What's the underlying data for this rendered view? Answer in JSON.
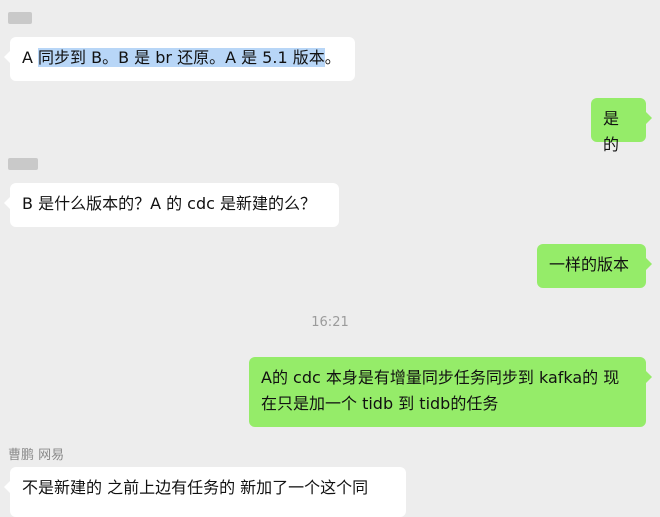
{
  "conversation": {
    "messages": [
      {
        "id": "m1",
        "direction": "incoming",
        "sender": "",
        "prefix": "A ",
        "selected": "同步到 B。B 是 br 还原。A 是 5.1 版本",
        "suffix": "。"
      },
      {
        "id": "m2",
        "direction": "outgoing",
        "text": "是的"
      },
      {
        "id": "m3",
        "direction": "incoming",
        "sender": "",
        "text": "B 是什么版本的？A 的 cdc 是新建的么？"
      },
      {
        "id": "m4",
        "direction": "outgoing",
        "text": "一样的版本"
      },
      {
        "id": "m5",
        "direction": "outgoing",
        "line1": "A的 cdc 本身是有增量同步任务同步到 kafka的 现",
        "line2": "在只是加一个 tidb 到 tidb的任务"
      },
      {
        "id": "m6",
        "direction": "incoming",
        "sender": "曹鹏 网易",
        "text": "不是新建的 之前上边有任务的 新加了一个这个同"
      }
    ],
    "timestamp": "16:21"
  },
  "theme": {
    "background": "#ededed",
    "incoming_bubble": "#ffffff",
    "outgoing_bubble": "#95ec69",
    "selection": "#b8d6f7",
    "meta_text": "#9b9b9b"
  }
}
